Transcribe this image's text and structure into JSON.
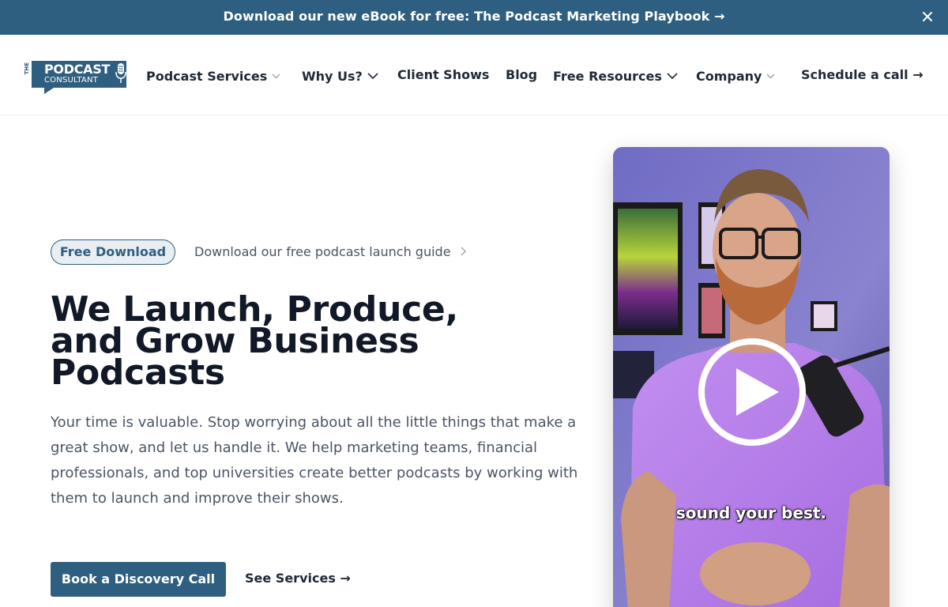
{
  "banner": {
    "text": "Download our new eBook for free: The Podcast Marketing Playbook →",
    "close_icon": "close-icon"
  },
  "logo": {
    "the": "THE",
    "title": "PODCAST",
    "subtitle": "CONSULTANT",
    "icon": "microphone-icon"
  },
  "nav": {
    "items": [
      {
        "label": "Podcast Services",
        "icon": "chevron-down-icon"
      },
      {
        "label": "Why Us?",
        "icon": "chevron-down-icon"
      },
      {
        "label": "Client Shows"
      },
      {
        "label": "Blog"
      },
      {
        "label": "Free Resources",
        "icon": "chevron-down-icon"
      },
      {
        "label": "Company",
        "icon": "chevron-down-icon"
      }
    ],
    "cta": "Schedule a call →"
  },
  "hero": {
    "badge": "Free Download",
    "badge_link": "Download our free podcast launch guide",
    "headline_lines": [
      "We Launch, Produce,",
      "and Grow Business",
      "Podcasts"
    ],
    "description": "Your time is valuable. Stop worrying about all the little things that make a great show, and let us handle it. We help marketing teams, financial professionals, and top universities create better podcasts by working with them to launch and improve their shows.",
    "primary_cta": "Book a Discovery Call",
    "secondary_cta": "See Services →"
  },
  "video": {
    "caption": "sound your best.",
    "play_icon": "play-icon",
    "accent": "#2f5f80"
  }
}
